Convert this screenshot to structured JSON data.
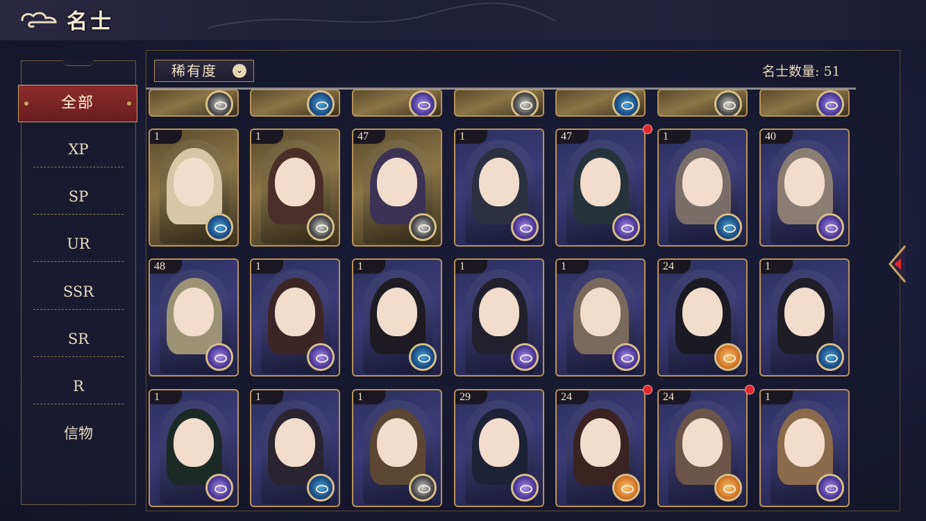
{
  "header": {
    "title": "名士"
  },
  "sidebar": {
    "active": "全部",
    "items": [
      "XP",
      "SP",
      "UR",
      "SSR",
      "SR",
      "R",
      "信物"
    ]
  },
  "toolbar": {
    "sort_label": "稀有度",
    "count_label": "名士数量: 51"
  },
  "colors": {
    "accent_gold": "#b8945a",
    "active_red": "#8c2c2c",
    "background": "#16182e",
    "notify_red": "#e02a30"
  },
  "rows": [
    [
      {
        "level": "1",
        "frame": "gold",
        "element": "water",
        "hair": "#d8c7a6",
        "notify": false
      },
      {
        "level": "1",
        "frame": "gold",
        "element": "wind",
        "hair": "#4a2f28",
        "notify": false
      },
      {
        "level": "47",
        "frame": "gold",
        "element": "wind",
        "hair": "#3c3254",
        "notify": false
      },
      {
        "level": "1",
        "frame": "purple",
        "element": "star",
        "hair": "#2c3040",
        "notify": false
      },
      {
        "level": "47",
        "frame": "purple",
        "element": "star",
        "hair": "#26333a",
        "notify": true
      },
      {
        "level": "1",
        "frame": "purple",
        "element": "water",
        "hair": "#7a6e68",
        "notify": false
      },
      {
        "level": "40",
        "frame": "purple",
        "element": "star",
        "hair": "#8b7d72",
        "notify": false
      }
    ],
    [
      {
        "level": "48",
        "frame": "purple",
        "element": "star",
        "hair": "#9c9377",
        "notify": false
      },
      {
        "level": "1",
        "frame": "purple",
        "element": "star",
        "hair": "#3b2625",
        "notify": false
      },
      {
        "level": "1",
        "frame": "purple",
        "element": "water",
        "hair": "#1e1c22",
        "notify": false
      },
      {
        "level": "1",
        "frame": "purple",
        "element": "star",
        "hair": "#22202c",
        "notify": false
      },
      {
        "level": "1",
        "frame": "purple",
        "element": "star",
        "hair": "#7a6a5c",
        "notify": false
      },
      {
        "level": "24",
        "frame": "purple",
        "element": "fire",
        "hair": "#1b1a22",
        "notify": false
      },
      {
        "level": "1",
        "frame": "purple",
        "element": "water",
        "hair": "#1f1d26",
        "notify": false
      }
    ],
    [
      {
        "level": "1",
        "frame": "purple",
        "element": "star",
        "hair": "#1c2a26",
        "notify": false
      },
      {
        "level": "1",
        "frame": "purple",
        "element": "water",
        "hair": "#2a2430",
        "notify": false
      },
      {
        "level": "1",
        "frame": "purple",
        "element": "wind",
        "hair": "#5b4634",
        "notify": false
      },
      {
        "level": "29",
        "frame": "purple",
        "element": "star",
        "hair": "#1e2236",
        "notify": false
      },
      {
        "level": "24",
        "frame": "purple",
        "element": "fire",
        "hair": "#3a2320",
        "notify": true
      },
      {
        "level": "24",
        "frame": "purple",
        "element": "fire",
        "hair": "#6b5548",
        "notify": true
      },
      {
        "level": "1",
        "frame": "purple",
        "element": "star",
        "hair": "#8b6b4c",
        "notify": false
      }
    ]
  ],
  "partial_row": [
    {
      "frame": "gold",
      "element": "wind"
    },
    {
      "frame": "gold",
      "element": "water"
    },
    {
      "frame": "gold",
      "element": "star"
    },
    {
      "frame": "gold",
      "element": "wind"
    },
    {
      "frame": "gold",
      "element": "water"
    },
    {
      "frame": "gold",
      "element": "wind"
    },
    {
      "frame": "gold",
      "element": "star"
    }
  ]
}
